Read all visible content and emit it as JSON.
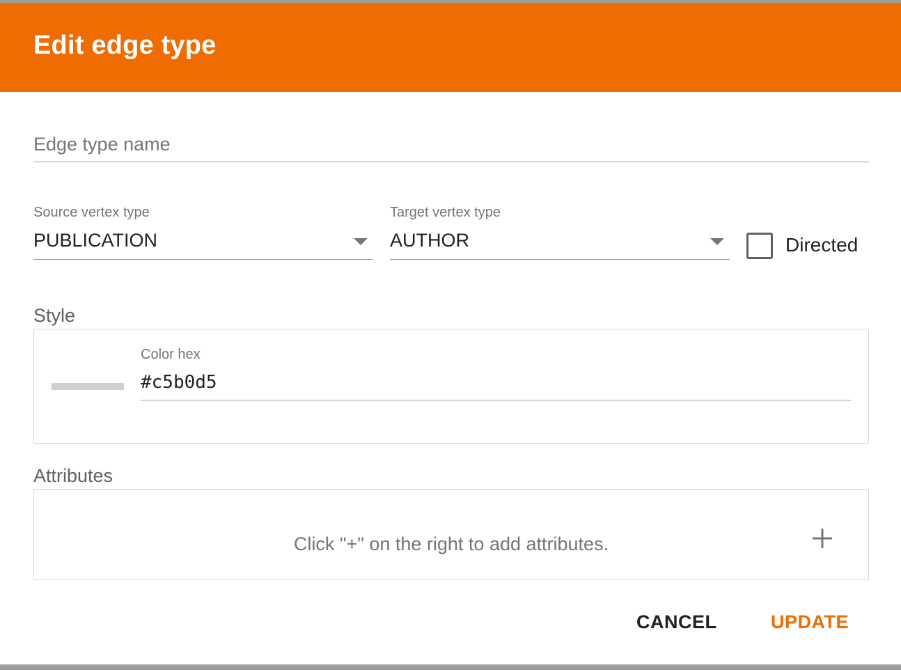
{
  "dialog": {
    "title": "Edit edge type"
  },
  "edge_type_name": {
    "placeholder": "Edge type name",
    "value": ""
  },
  "source_vertex": {
    "label": "Source vertex type",
    "value": "PUBLICATION"
  },
  "target_vertex": {
    "label": "Target vertex type",
    "value": "AUTHOR"
  },
  "directed": {
    "label": "Directed",
    "checked": false
  },
  "style": {
    "title": "Style",
    "color_label": "Color hex",
    "color_value": "#c5b0d5",
    "swatch_color": "#cfcfcf"
  },
  "attributes": {
    "title": "Attributes",
    "empty_message": "Click \"+\" on the right to add attributes.",
    "add_icon": "plus-icon"
  },
  "actions": {
    "cancel_label": "CANCEL",
    "update_label": "UPDATE"
  },
  "colors": {
    "accent": "#ef6c00",
    "header_text": "#ffffff"
  }
}
